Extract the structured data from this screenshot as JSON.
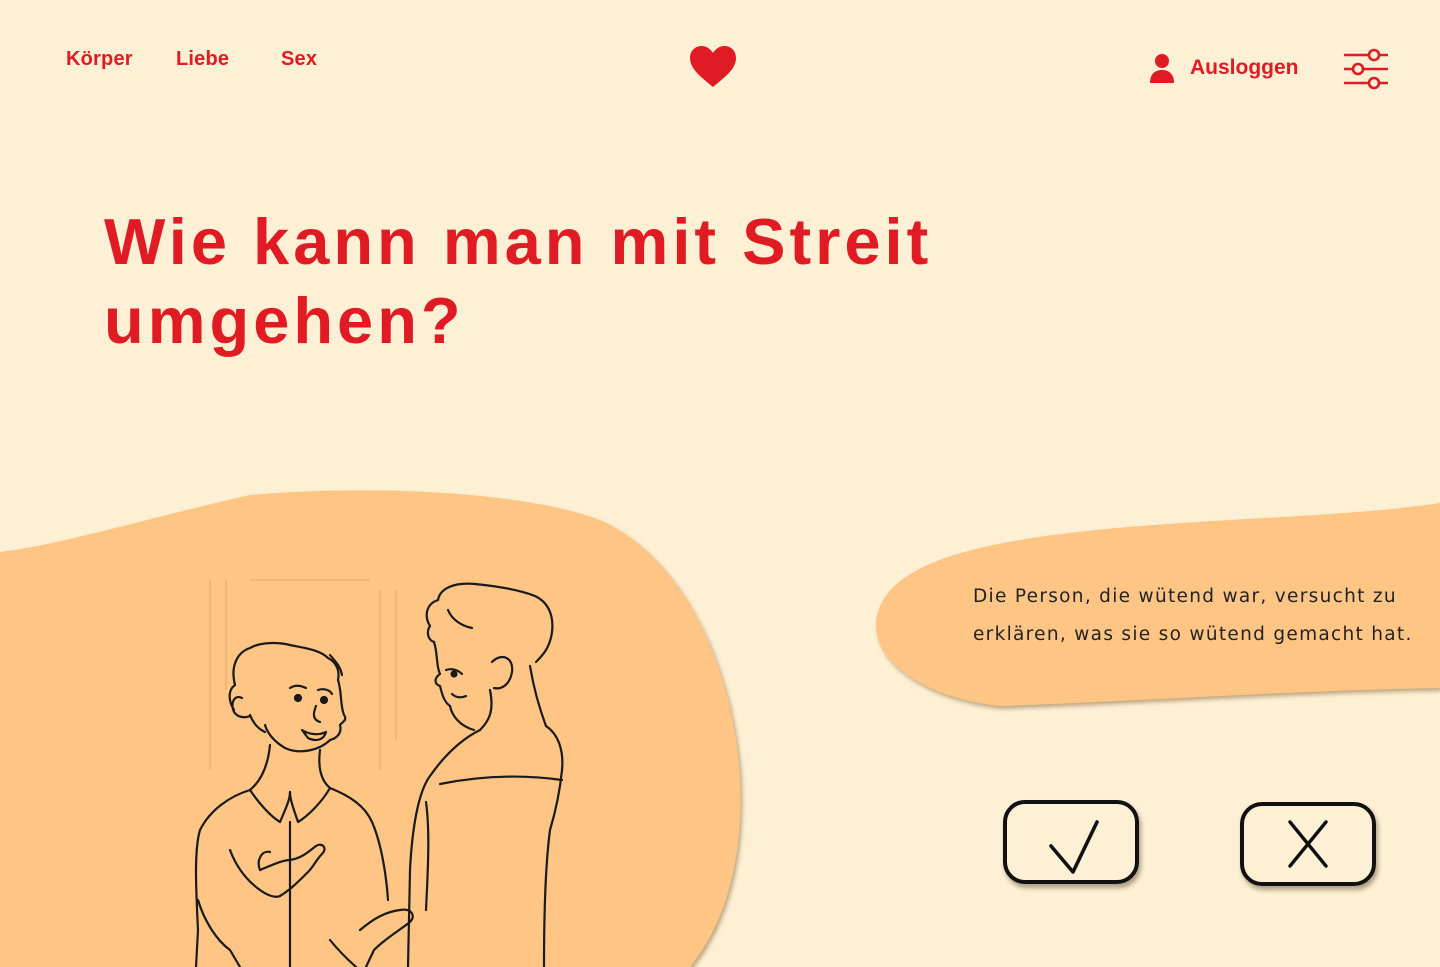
{
  "nav": {
    "items": [
      {
        "label": "Körper"
      },
      {
        "label": "Liebe"
      },
      {
        "label": "Sex"
      }
    ]
  },
  "header": {
    "logo_icon": "heart-icon",
    "logout_label": "Ausloggen",
    "user_icon": "user-icon",
    "settings_icon": "sliders-icon"
  },
  "main": {
    "title": "Wie kann man mit Streit umgehen?",
    "caption": "Die Person, die wütend war, versucht zu erklären, was sie so wütend gemacht hat.",
    "illustration_icon": "two-people-talking-sketch",
    "answers": {
      "accept_icon": "checkmark-icon",
      "reject_icon": "close-icon"
    }
  },
  "colors": {
    "background": "#fdf0d5",
    "accent": "#e01b24",
    "blob": "#fec584",
    "outline": "#111111"
  }
}
